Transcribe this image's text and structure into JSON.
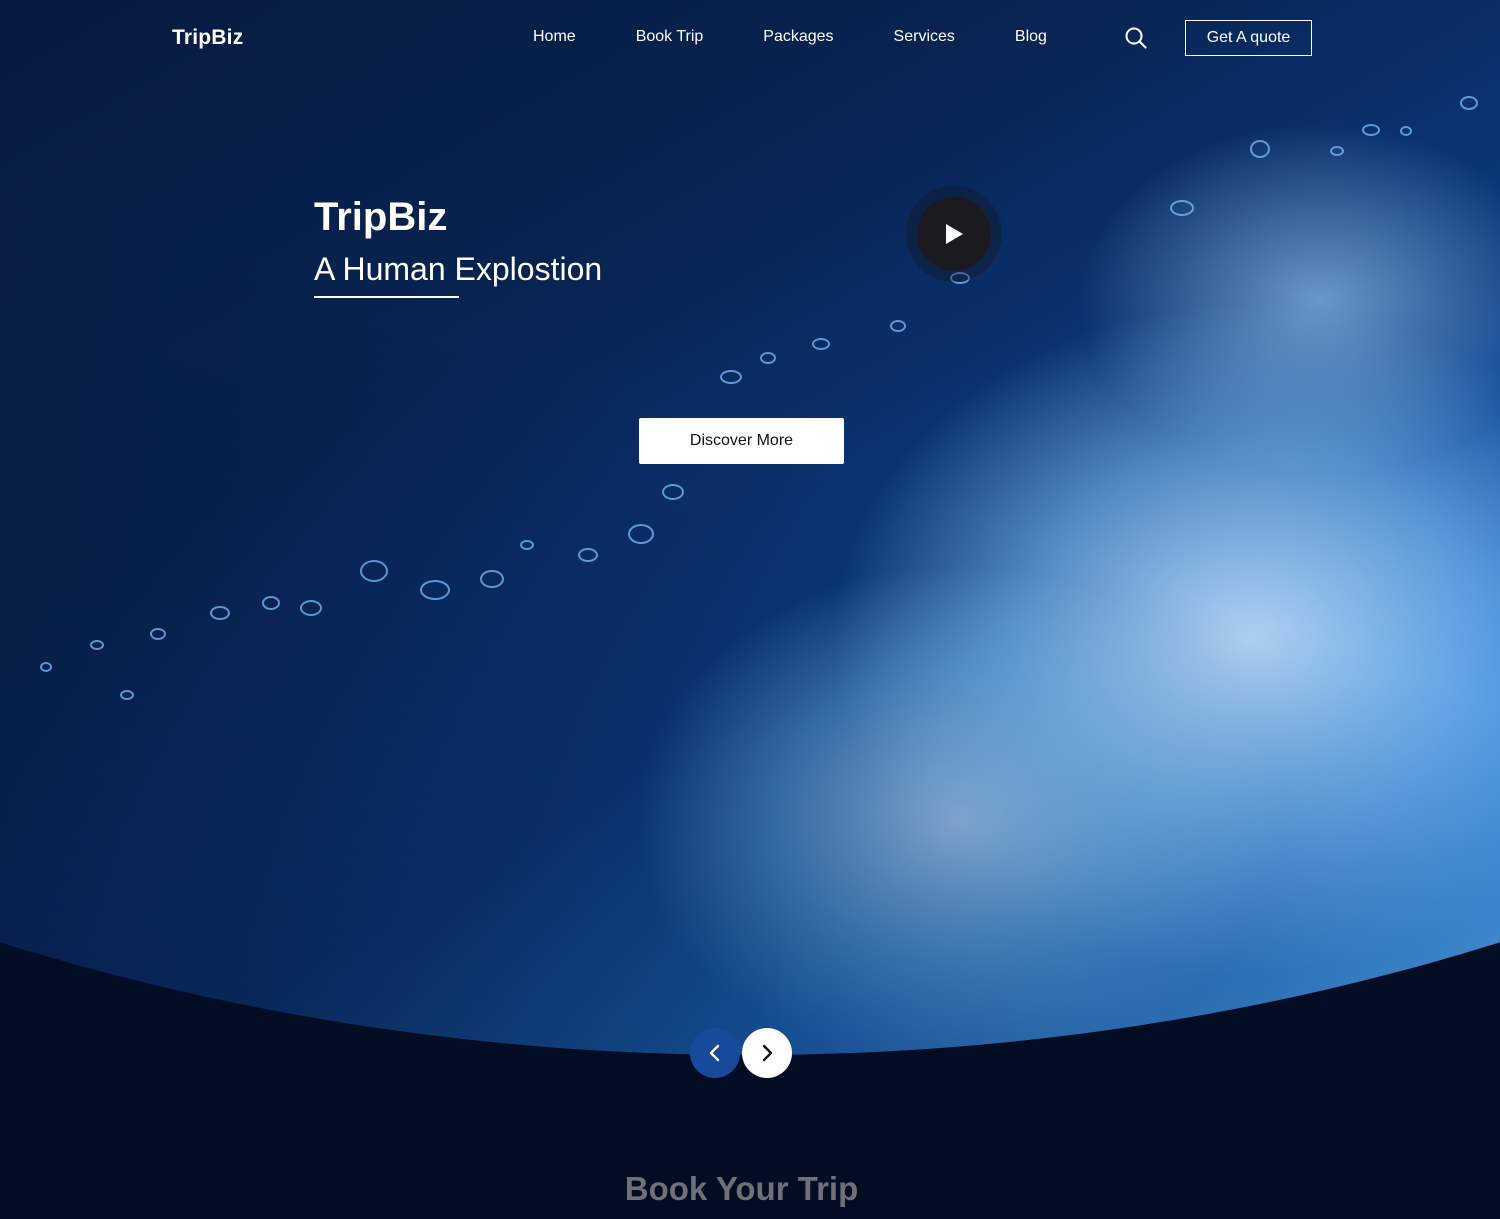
{
  "brand": {
    "name": "TripBiz"
  },
  "nav": {
    "items": [
      {
        "label": "Home"
      },
      {
        "label": "Book Trip"
      },
      {
        "label": "Packages"
      },
      {
        "label": "Services"
      },
      {
        "label": "Blog"
      }
    ],
    "search_icon": "search-icon",
    "cta_label": "Get A quote"
  },
  "hero": {
    "title": "TripBiz",
    "subtitle": "A Human Explostion",
    "cta_label": "Discover More",
    "play_icon": "play-icon"
  },
  "slider": {
    "prev_icon": "chevron-left-icon",
    "next_icon": "chevron-right-icon"
  },
  "section": {
    "title": "Book Your Trip"
  },
  "colors": {
    "page_background": "#020c22",
    "accent_blue": "#184a9b",
    "section_title": "#6f7078"
  }
}
